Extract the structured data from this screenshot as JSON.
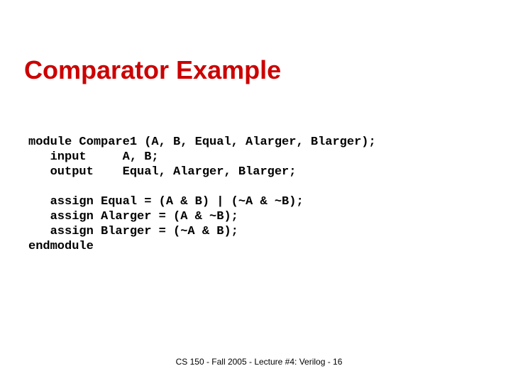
{
  "title": "Comparator Example",
  "code": "module Compare1 (A, B, Equal, Alarger, Blarger);\n   input     A, B;\n   output    Equal, Alarger, Blarger;\n\n   assign Equal = (A & B) | (~A & ~B);\n   assign Alarger = (A & ~B);\n   assign Blarger = (~A & B);\nendmodule",
  "footer": "CS 150 - Fall 2005 - Lecture #4: Verilog - 16"
}
